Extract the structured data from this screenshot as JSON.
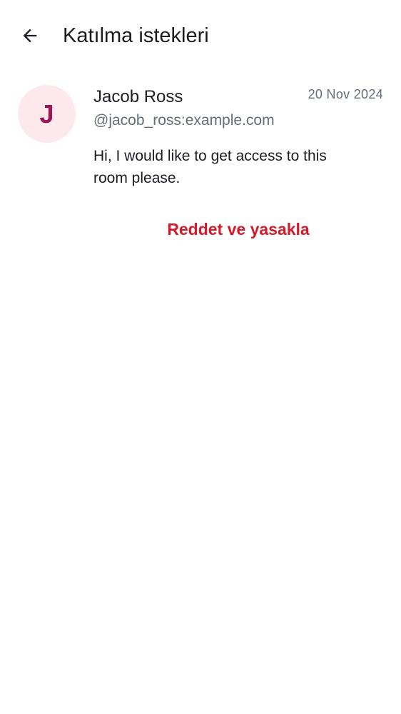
{
  "header": {
    "title": "Katılma istekleri",
    "back_icon": "arrow-left-icon"
  },
  "request": {
    "avatar_initial": "J",
    "avatar_background": "#fde8ee",
    "avatar_color": "#9b1652",
    "display_name": "Jacob Ross",
    "user_id": "@jacob_ross:example.com",
    "date": "20 Nov 2024",
    "message": "Hi, I would like to get access to this room please.",
    "decline_and_ban_label": "Reddet ve yasakla",
    "decline_color": "#d51928"
  }
}
